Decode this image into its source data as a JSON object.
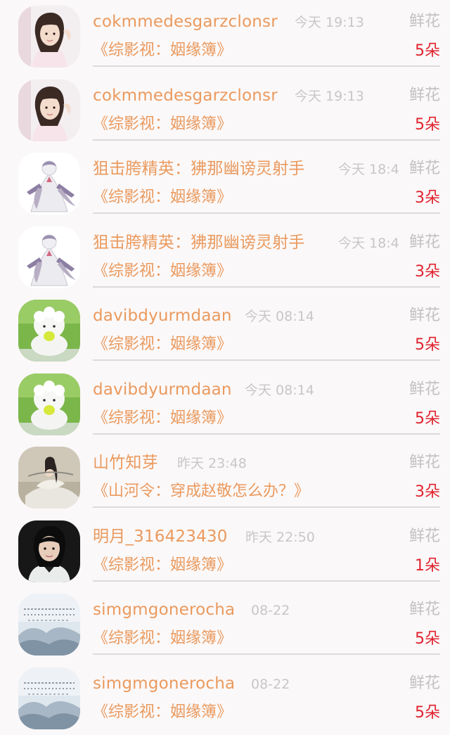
{
  "rows": [
    {
      "name": "cokmmedesgarzclonsr",
      "time": "今天 19:13",
      "gift": "鲜花",
      "book": "《综影视：姻缘簿》",
      "count": "5朵",
      "avatar": "girl-portrait"
    },
    {
      "name": "cokmmedesgarzclonsr",
      "time": "今天 19:13",
      "gift": "鲜花",
      "book": "《综影视：姻缘簿》",
      "count": "5朵",
      "avatar": "girl-portrait"
    },
    {
      "name": "狙击胯精英：狒那幽谤灵射手",
      "time": "今天 18:4",
      "gift": "鲜花",
      "book": "《综影视：姻缘簿》",
      "count": "3朵",
      "avatar": "gardevoir-figure"
    },
    {
      "name": "狙击胯精英：狒那幽谤灵射手",
      "time": "今天 18:4",
      "gift": "鲜花",
      "book": "《综影视：姻缘簿》",
      "count": "3朵",
      "avatar": "gardevoir-figure"
    },
    {
      "name": "davibdyurmdaan",
      "time": "今天 08:14",
      "gift": "鲜花",
      "book": "《综影视：姻缘簿》",
      "count": "5朵",
      "avatar": "sheep-plush"
    },
    {
      "name": "davibdyurmdaan",
      "time": "今天 08:14",
      "gift": "鲜花",
      "book": "《综影视：姻缘簿》",
      "count": "5朵",
      "avatar": "sheep-plush"
    },
    {
      "name": "山竹知芽",
      "time": "昨天 23:48",
      "gift": "鲜花",
      "book": "《山河令：穿成赵敬怎么办？》",
      "count": "3朵",
      "avatar": "ancient-costume"
    },
    {
      "name": "明月_316423430",
      "time": "昨天 22:50",
      "gift": "鲜花",
      "book": "《综影视：姻缘簿》",
      "count": "1朵",
      "avatar": "woman-portrait"
    },
    {
      "name": "simgmgonerocha",
      "time": "08-22",
      "gift": "鲜花",
      "book": "《综影视：姻缘簿》",
      "count": "5朵",
      "avatar": "cloud-calligraphy"
    },
    {
      "name": "simgmgonerocha",
      "time": "08-22",
      "gift": "鲜花",
      "book": "《综影视：姻缘簿》",
      "count": "5朵",
      "avatar": "cloud-calligraphy"
    }
  ],
  "colors": {
    "name": "#ea9a5e",
    "time": "#c9c6c7",
    "gift": "#c4c1c2",
    "count": "#e0232f",
    "divider": "#dedadb",
    "background": "#fbf8f9"
  }
}
